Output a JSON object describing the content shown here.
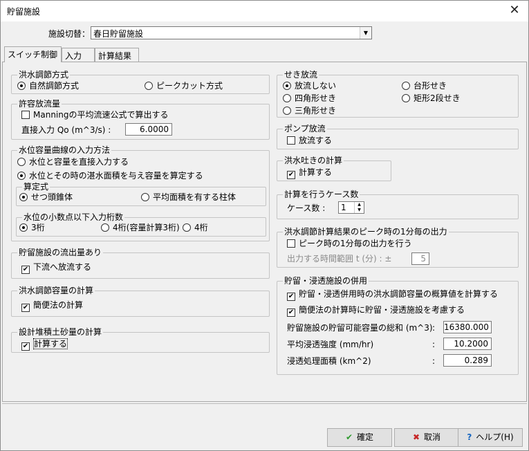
{
  "window": {
    "title": "貯留施設",
    "close_icon": "close-icon"
  },
  "switch": {
    "label": "施設切替：",
    "value": "春日貯留施設"
  },
  "tabs": [
    "スイッチ制御",
    "入力",
    "計算結果"
  ],
  "left": {
    "flood_method": {
      "legend": "洪水調節方式",
      "opt1": "自然調節方式",
      "opt2": "ピークカット方式",
      "selected": "opt1"
    },
    "allow": {
      "legend": "許容放流量",
      "manning": "Manningの平均流速公式で算出する",
      "direct_label": "直接入力 Qo (m^3/s) :",
      "direct_value": "6.0000"
    },
    "curve": {
      "legend": "水位容量曲線の入力方法",
      "opt1": "水位と容量を直接入力する",
      "opt2": "水位とその時の湛水面積を与え容量を算定する",
      "formula_legend": "算定式",
      "formula1": "せつ頭錐体",
      "formula2": "平均面積を有する柱体",
      "decimal_legend": "水位の小数点以下入力桁数",
      "dec1": "3桁",
      "dec2": "4桁(容量計算3桁)",
      "dec3": "4桁"
    },
    "outflow": {
      "legend": "貯留施設の流出量あり",
      "check": "下流へ放流する"
    },
    "capacity": {
      "legend": "洪水調節容量の計算",
      "check": "簡便法の計算"
    },
    "sediment": {
      "legend": "設計堆積土砂量の計算",
      "check": "計算する"
    }
  },
  "right": {
    "weir": {
      "legend": "せき放流",
      "o1": "放流しない",
      "o2": "台形せき",
      "o3": "四角形せき",
      "o4": "矩形2段せき",
      "o5": "三角形せき"
    },
    "pump": {
      "legend": "ポンプ放流",
      "check": "放流する"
    },
    "spill": {
      "legend": "洪水吐きの計算",
      "check": "計算する"
    },
    "cases": {
      "legend": "計算を行うケース数",
      "label": "ケース数 :",
      "value": "1"
    },
    "peak": {
      "legend": "洪水調節計算結果のピーク時の1分毎の出力",
      "check": "ピーク時の1分毎の出力を行う",
      "range_label": "出力する時間範囲 t (分) : ±",
      "range_value": "5"
    },
    "infiltration": {
      "legend": "貯留・浸透施設の併用",
      "check1": "貯留・浸透併用時の洪水調節容量の概算値を計算する",
      "check2": "簡便法の計算時に貯留・浸透施設を考慮する",
      "f1_label": "貯留施設の貯留可能容量の総和 (m^3)",
      "f1_value": "16380.000",
      "f2_label": "平均浸透強度 (mm/hr)",
      "f2_value": "10.2000",
      "f3_label": "浸透処理面積 (km^2)",
      "f3_value": "0.289",
      "colon": ":"
    }
  },
  "buttons": {
    "ok": "確定",
    "cancel": "取消",
    "help": "ヘルプ(H)"
  }
}
